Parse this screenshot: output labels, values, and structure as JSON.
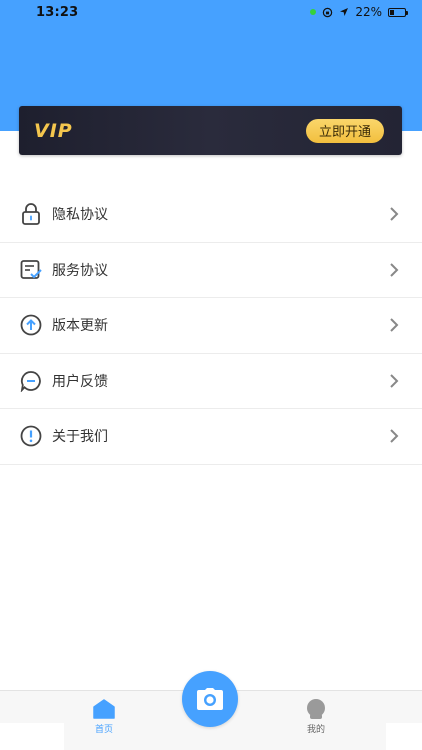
{
  "status_bar": {
    "time": "13:23",
    "battery": "22%"
  },
  "vip": {
    "logo": "VIP",
    "cta": "立即开通"
  },
  "menu": {
    "items": [
      {
        "id": "privacy",
        "label": "隐私协议",
        "icon": "lock-icon"
      },
      {
        "id": "service",
        "label": "服务协议",
        "icon": "document-check-icon"
      },
      {
        "id": "update",
        "label": "版本更新",
        "icon": "arrow-up-circle-icon"
      },
      {
        "id": "feedback",
        "label": "用户反馈",
        "icon": "chat-bubble-icon"
      },
      {
        "id": "about",
        "label": "关于我们",
        "icon": "info-exclamation-icon"
      }
    ]
  },
  "tabbar": {
    "home": {
      "label": "首页",
      "icon": "home-icon"
    },
    "camera": {
      "icon": "camera-icon"
    },
    "mine": {
      "label": "我的",
      "icon": "user-avatar-icon"
    }
  },
  "colors": {
    "primary": "#46A1FF",
    "vip_gold": "#F4C64E",
    "vip_dark": "#22232f"
  }
}
